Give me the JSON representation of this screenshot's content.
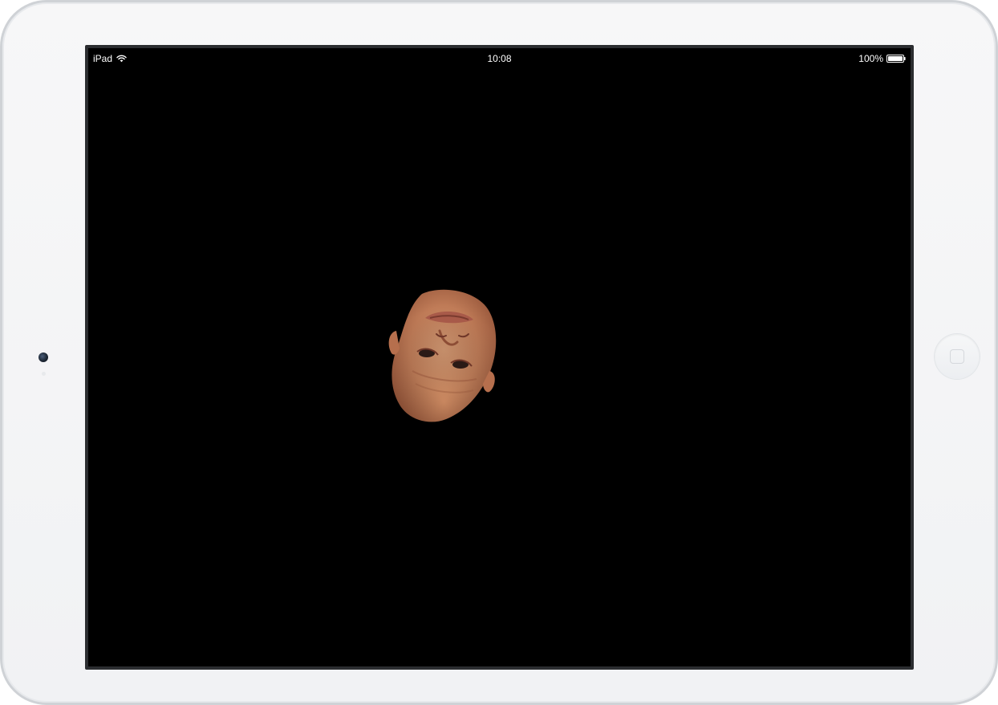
{
  "device": {
    "name": "iPad"
  },
  "status_bar": {
    "carrier": "iPad",
    "time": "10:08",
    "battery_percent": "100%",
    "wifi_icon": "wifi-icon",
    "battery_icon": "battery-icon",
    "battery_level": 1.0
  },
  "content": {
    "background_color": "#000000",
    "image": "upside-down-face-image"
  },
  "colors": {
    "bezel": "#f3f4f6",
    "screen": "#000000",
    "status_text": "#ffffff"
  }
}
